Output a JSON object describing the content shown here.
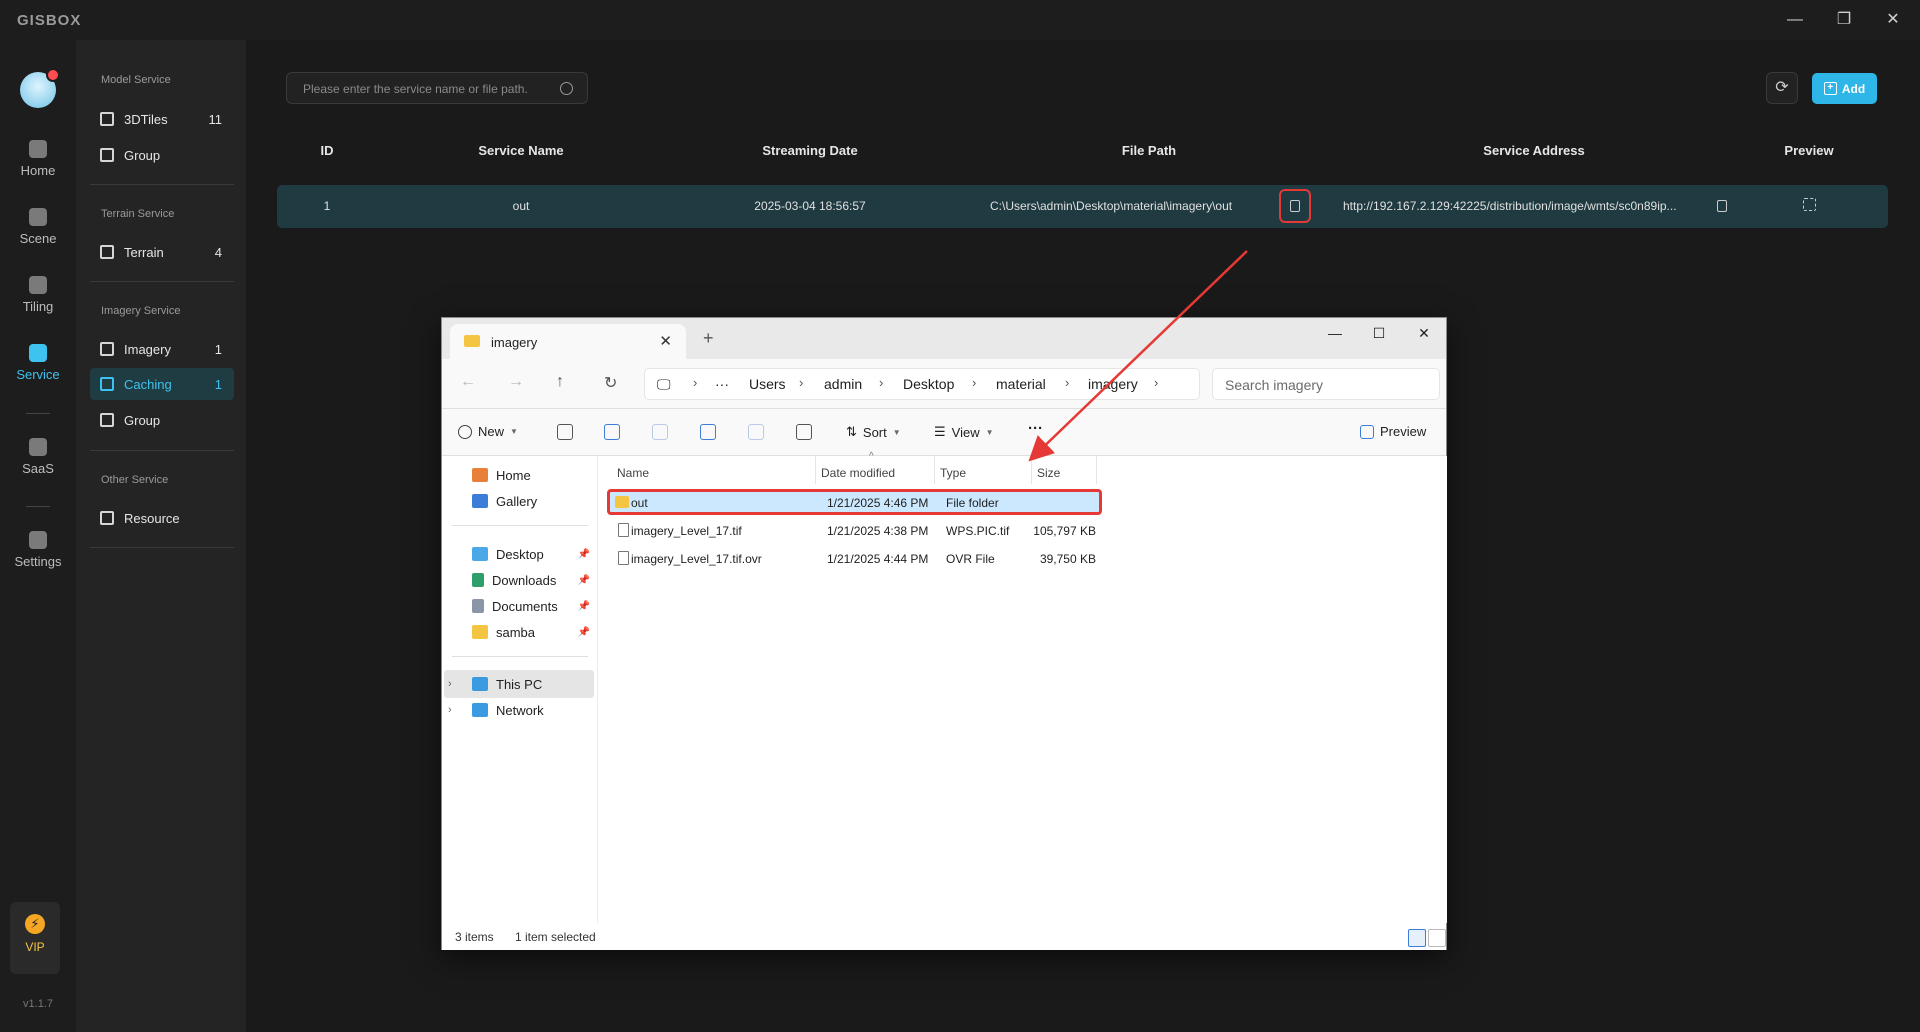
{
  "app": {
    "brand": "GISBOX",
    "version": "v1.1.7"
  },
  "window_controls": [
    "—",
    "❐",
    "✕"
  ],
  "rail": [
    {
      "label": "Home",
      "icon": "home-icon"
    },
    {
      "label": "Scene",
      "icon": "scene-icon"
    },
    {
      "label": "Tiling",
      "icon": "tiling-icon"
    },
    {
      "label": "Service",
      "icon": "service-icon",
      "active": true
    },
    {
      "label": "SaaS",
      "icon": "saas-icon"
    },
    {
      "label": "Settings",
      "icon": "settings-icon"
    }
  ],
  "vip": {
    "label": "VIP",
    "glyph": "⚡"
  },
  "sidebar": {
    "model_title": "Model Service",
    "model_items": [
      {
        "label": "3DTiles",
        "count": "11"
      },
      {
        "label": "Group",
        "count": ""
      }
    ],
    "terrain_title": "Terrain Service",
    "terrain_items": [
      {
        "label": "Terrain",
        "count": "4"
      }
    ],
    "imagery_title": "Imagery Service",
    "imagery_items": [
      {
        "label": "Imagery",
        "count": "1"
      },
      {
        "label": "Caching",
        "count": "1"
      },
      {
        "label": "Group",
        "count": ""
      }
    ],
    "other_title": "Other Service",
    "other_items": [
      {
        "label": "Resource",
        "count": ""
      }
    ]
  },
  "main": {
    "search_placeholder": "Please enter the service name or file path.",
    "add_label": "Add",
    "columns": [
      "ID",
      "Service Name",
      "Streaming Date",
      "File Path",
      "Service Address",
      "Preview"
    ],
    "rows": [
      {
        "id": "1",
        "name": "out",
        "date": "2025-03-04 18:56:57",
        "path": "C:\\Users\\admin\\Desktop\\material\\imagery\\out",
        "address": "http://192.167.2.129:42225/distribution/image/wmts/sc0n89ip..."
      }
    ]
  },
  "explorer": {
    "tab_title": "imagery",
    "crumbs": [
      "Users",
      "admin",
      "Desktop",
      "material",
      "imagery"
    ],
    "search_placeholder": "Search imagery",
    "commands": {
      "new": "New",
      "sort": "Sort",
      "view": "View",
      "more": "···",
      "preview": "Preview"
    },
    "nav": {
      "top": [
        {
          "label": "Home"
        },
        {
          "label": "Gallery"
        }
      ],
      "quick": [
        {
          "label": "Desktop"
        },
        {
          "label": "Downloads"
        },
        {
          "label": "Documents"
        },
        {
          "label": "samba"
        }
      ],
      "bottom": [
        {
          "label": "This PC"
        },
        {
          "label": "Network"
        }
      ]
    },
    "columns": [
      "Name",
      "Date modified",
      "Type",
      "Size"
    ],
    "files": [
      {
        "name": "out",
        "date": "1/21/2025 4:46 PM",
        "type": "File folder",
        "size": "",
        "kind": "folder"
      },
      {
        "name": "imagery_Level_17.tif",
        "date": "1/21/2025 4:38 PM",
        "type": "WPS.PIC.tif",
        "size": "105,797 KB",
        "kind": "file"
      },
      {
        "name": "imagery_Level_17.tif.ovr",
        "date": "1/21/2025 4:44 PM",
        "type": "OVR File",
        "size": "39,750 KB",
        "kind": "file"
      }
    ],
    "status": {
      "items": "3 items",
      "selected": "1 item selected"
    }
  },
  "colors": {
    "accent": "#2fb6e8",
    "highlight_red": "#e53935",
    "row_bg": "#1f3a40"
  }
}
